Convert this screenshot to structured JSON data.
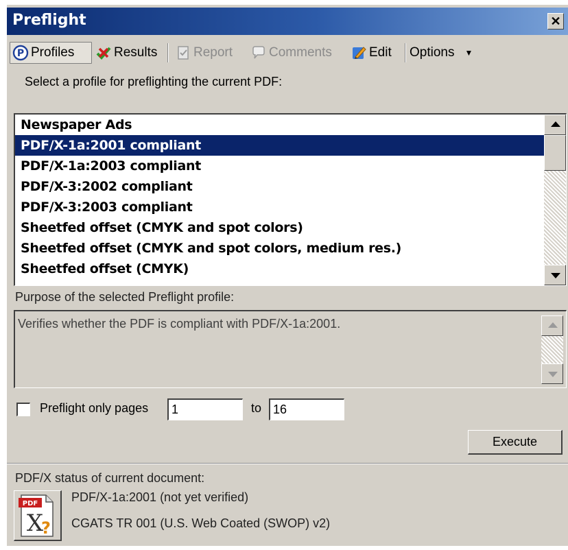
{
  "window": {
    "title": "Preflight"
  },
  "toolbar": {
    "profiles": "Profiles",
    "results": "Results",
    "report": "Report",
    "comments": "Comments",
    "edit": "Edit",
    "options": "Options"
  },
  "instructions": "Select a profile for preflighting the current PDF:",
  "profiles": [
    "Newspaper Ads",
    "PDF/X-1a:2001 compliant",
    "PDF/X-1a:2003 compliant",
    "PDF/X-3:2002 compliant",
    "PDF/X-3:2003 compliant",
    "Sheetfed offset (CMYK and spot colors)",
    "Sheetfed offset (CMYK and spot colors, medium res.)",
    "Sheetfed offset (CMYK)"
  ],
  "selected_index": 1,
  "purpose": {
    "label": "Purpose of the selected Preflight profile:",
    "text": "Verifies whether the PDF is compliant with PDF/X-1a:2001."
  },
  "page_range": {
    "checkbox_label": "Preflight only pages",
    "checked": false,
    "from": "1",
    "to_label": "to",
    "to": "16"
  },
  "execute_label": "Execute",
  "status": {
    "label": "PDF/X status of current document:",
    "line1": "PDF/X-1a:2001 (not yet verified)",
    "line2": "CGATS TR 001 (U.S. Web Coated (SWOP) v2)"
  },
  "colors": {
    "selection": "#0a246a",
    "titlebar_start": "#0b2a6f",
    "face": "#d4d0c8"
  }
}
